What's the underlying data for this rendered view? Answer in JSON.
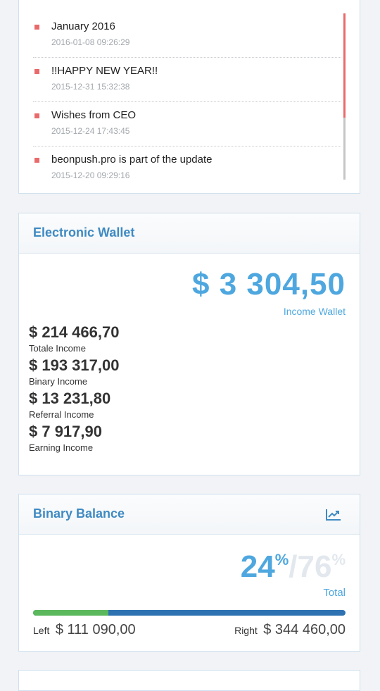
{
  "news": {
    "items": [
      {
        "title": "January 2016",
        "date": "2016-01-08 09:26:29"
      },
      {
        "title": "!!HAPPY NEW YEAR!!",
        "date": "2015-12-31 15:32:38"
      },
      {
        "title": "Wishes from CEO",
        "date": "2015-12-24 17:43:45"
      },
      {
        "title": "beonpush.pro is part of the update",
        "date": "2015-12-20 09:29:16"
      }
    ]
  },
  "wallet": {
    "title": "Electronic Wallet",
    "main_amount": "$ 3 304,50",
    "main_label": "Income Wallet",
    "stats": [
      {
        "amount": "$ 214 466,70",
        "label": "Totale Income"
      },
      {
        "amount": "$ 193 317,00",
        "label": "Binary Income"
      },
      {
        "amount": "$ 13 231,80",
        "label": "Referral Income"
      },
      {
        "amount": "$ 7 917,90",
        "label": "Earning Income"
      }
    ]
  },
  "binary": {
    "title": "Binary Balance",
    "icon": "line-chart-icon",
    "left_percent": "24",
    "right_percent": "76",
    "percent_sign": "%",
    "slash": "/",
    "total_label": "Total",
    "left_fraction": 0.24,
    "left_label": "Left",
    "left_value": "$ 111 090,00",
    "right_label": "Right",
    "right_value": "$ 344 460,00"
  },
  "colors": {
    "accent": "#4ea7df",
    "title": "#3f8ac2",
    "bullet": "#e86a6a",
    "bar_left": "#5cb85c",
    "bar_right": "#2f72b2"
  }
}
